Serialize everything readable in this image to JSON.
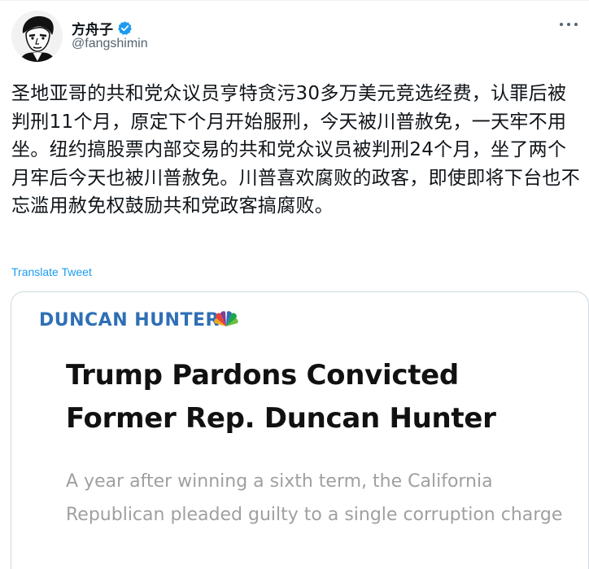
{
  "author": {
    "display_name": "方舟子",
    "handle": "@fangshimin",
    "verified_icon": "verified-badge-icon",
    "avatar_icon": "portrait-avatar"
  },
  "tweet": {
    "text": "圣地亚哥的共和党众议员亨特贪污30多万美元竞选经费，认罪后被判刑11个月，原定下个月开始服刑，今天被川普赦免，一天牢不用坐。纽约搞股票内部交易的共和党众议员被判刑24个月，坐了两个月牢后今天也被川普赦免。川普喜欢腐败的政客，即使即将下台也不忘滥用赦免权鼓励共和党政客搞腐败。",
    "translate_label": "Translate Tweet"
  },
  "card": {
    "kicker": "DUNCAN HUNTER",
    "logo_icon": "nbc-peacock-icon",
    "headline": "Trump Pardons Convicted Former Rep. Duncan Hunter",
    "subhead": "A year after winning a sixth term, the California Republican pleaded guilty to a single corruption charge"
  },
  "colors": {
    "accent": "#1d9bf0",
    "kicker": "#2f6fb5",
    "text": "#0f1419",
    "muted": "#536471",
    "subhead": "#a0a0a0"
  }
}
